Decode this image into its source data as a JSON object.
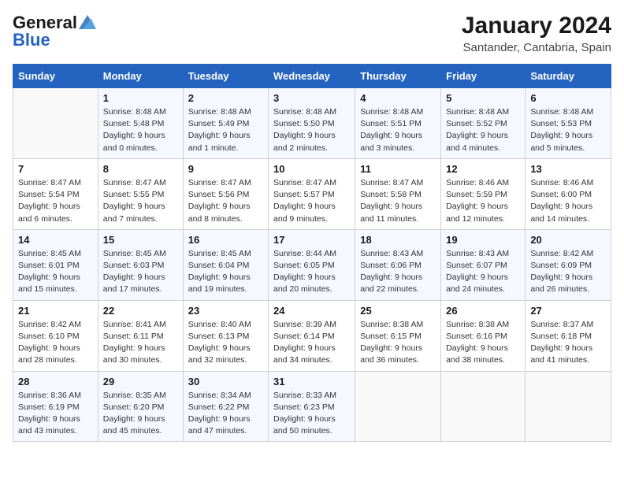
{
  "header": {
    "logo_general": "General",
    "logo_blue": "Blue",
    "title": "January 2024",
    "subtitle": "Santander, Cantabria, Spain"
  },
  "weekdays": [
    "Sunday",
    "Monday",
    "Tuesday",
    "Wednesday",
    "Thursday",
    "Friday",
    "Saturday"
  ],
  "weeks": [
    [
      {
        "day": "",
        "info": ""
      },
      {
        "day": "1",
        "info": "Sunrise: 8:48 AM\nSunset: 5:48 PM\nDaylight: 9 hours\nand 0 minutes."
      },
      {
        "day": "2",
        "info": "Sunrise: 8:48 AM\nSunset: 5:49 PM\nDaylight: 9 hours\nand 1 minute."
      },
      {
        "day": "3",
        "info": "Sunrise: 8:48 AM\nSunset: 5:50 PM\nDaylight: 9 hours\nand 2 minutes."
      },
      {
        "day": "4",
        "info": "Sunrise: 8:48 AM\nSunset: 5:51 PM\nDaylight: 9 hours\nand 3 minutes."
      },
      {
        "day": "5",
        "info": "Sunrise: 8:48 AM\nSunset: 5:52 PM\nDaylight: 9 hours\nand 4 minutes."
      },
      {
        "day": "6",
        "info": "Sunrise: 8:48 AM\nSunset: 5:53 PM\nDaylight: 9 hours\nand 5 minutes."
      }
    ],
    [
      {
        "day": "7",
        "info": "Sunrise: 8:47 AM\nSunset: 5:54 PM\nDaylight: 9 hours\nand 6 minutes."
      },
      {
        "day": "8",
        "info": "Sunrise: 8:47 AM\nSunset: 5:55 PM\nDaylight: 9 hours\nand 7 minutes."
      },
      {
        "day": "9",
        "info": "Sunrise: 8:47 AM\nSunset: 5:56 PM\nDaylight: 9 hours\nand 8 minutes."
      },
      {
        "day": "10",
        "info": "Sunrise: 8:47 AM\nSunset: 5:57 PM\nDaylight: 9 hours\nand 9 minutes."
      },
      {
        "day": "11",
        "info": "Sunrise: 8:47 AM\nSunset: 5:58 PM\nDaylight: 9 hours\nand 11 minutes."
      },
      {
        "day": "12",
        "info": "Sunrise: 8:46 AM\nSunset: 5:59 PM\nDaylight: 9 hours\nand 12 minutes."
      },
      {
        "day": "13",
        "info": "Sunrise: 8:46 AM\nSunset: 6:00 PM\nDaylight: 9 hours\nand 14 minutes."
      }
    ],
    [
      {
        "day": "14",
        "info": "Sunrise: 8:45 AM\nSunset: 6:01 PM\nDaylight: 9 hours\nand 15 minutes."
      },
      {
        "day": "15",
        "info": "Sunrise: 8:45 AM\nSunset: 6:03 PM\nDaylight: 9 hours\nand 17 minutes."
      },
      {
        "day": "16",
        "info": "Sunrise: 8:45 AM\nSunset: 6:04 PM\nDaylight: 9 hours\nand 19 minutes."
      },
      {
        "day": "17",
        "info": "Sunrise: 8:44 AM\nSunset: 6:05 PM\nDaylight: 9 hours\nand 20 minutes."
      },
      {
        "day": "18",
        "info": "Sunrise: 8:43 AM\nSunset: 6:06 PM\nDaylight: 9 hours\nand 22 minutes."
      },
      {
        "day": "19",
        "info": "Sunrise: 8:43 AM\nSunset: 6:07 PM\nDaylight: 9 hours\nand 24 minutes."
      },
      {
        "day": "20",
        "info": "Sunrise: 8:42 AM\nSunset: 6:09 PM\nDaylight: 9 hours\nand 26 minutes."
      }
    ],
    [
      {
        "day": "21",
        "info": "Sunrise: 8:42 AM\nSunset: 6:10 PM\nDaylight: 9 hours\nand 28 minutes."
      },
      {
        "day": "22",
        "info": "Sunrise: 8:41 AM\nSunset: 6:11 PM\nDaylight: 9 hours\nand 30 minutes."
      },
      {
        "day": "23",
        "info": "Sunrise: 8:40 AM\nSunset: 6:13 PM\nDaylight: 9 hours\nand 32 minutes."
      },
      {
        "day": "24",
        "info": "Sunrise: 8:39 AM\nSunset: 6:14 PM\nDaylight: 9 hours\nand 34 minutes."
      },
      {
        "day": "25",
        "info": "Sunrise: 8:38 AM\nSunset: 6:15 PM\nDaylight: 9 hours\nand 36 minutes."
      },
      {
        "day": "26",
        "info": "Sunrise: 8:38 AM\nSunset: 6:16 PM\nDaylight: 9 hours\nand 38 minutes."
      },
      {
        "day": "27",
        "info": "Sunrise: 8:37 AM\nSunset: 6:18 PM\nDaylight: 9 hours\nand 41 minutes."
      }
    ],
    [
      {
        "day": "28",
        "info": "Sunrise: 8:36 AM\nSunset: 6:19 PM\nDaylight: 9 hours\nand 43 minutes."
      },
      {
        "day": "29",
        "info": "Sunrise: 8:35 AM\nSunset: 6:20 PM\nDaylight: 9 hours\nand 45 minutes."
      },
      {
        "day": "30",
        "info": "Sunrise: 8:34 AM\nSunset: 6:22 PM\nDaylight: 9 hours\nand 47 minutes."
      },
      {
        "day": "31",
        "info": "Sunrise: 8:33 AM\nSunset: 6:23 PM\nDaylight: 9 hours\nand 50 minutes."
      },
      {
        "day": "",
        "info": ""
      },
      {
        "day": "",
        "info": ""
      },
      {
        "day": "",
        "info": ""
      }
    ]
  ]
}
